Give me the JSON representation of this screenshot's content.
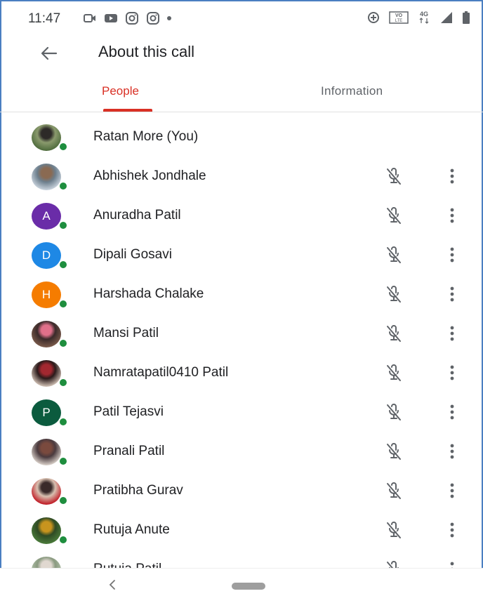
{
  "status_bar": {
    "time": "11:47",
    "left_icons": [
      "video-call-icon",
      "youtube-icon",
      "instagram-icon",
      "instagram-icon"
    ],
    "right_icons": [
      "data-saver-icon",
      "volte-icon",
      "4g-icon",
      "signal-icon",
      "battery-icon"
    ],
    "right_text": {
      "volte": "VO LTE",
      "network": "4G"
    }
  },
  "app_bar": {
    "title": "About this call"
  },
  "tabs": [
    {
      "label": "People",
      "selected": true
    },
    {
      "label": "Information",
      "selected": false
    }
  ],
  "colors": {
    "accent": "#d93025",
    "online": "#1e8e3e",
    "text_primary": "#202124",
    "text_secondary": "#5f6368"
  },
  "people": [
    {
      "name": "Ratan More (You)",
      "avatar_type": "photo",
      "photo_colors": [
        "#4e6b3c",
        "#2d2a28",
        "#8a9a6d"
      ],
      "is_self": true
    },
    {
      "name": "Abhishek Jondhale",
      "avatar_type": "photo",
      "photo_colors": [
        "#c8d2dc",
        "#8a6a52",
        "#6c7e8c"
      ],
      "is_self": false
    },
    {
      "name": "Anuradha Patil",
      "avatar_type": "letter",
      "letter": "A",
      "color": "#6a2ca8",
      "is_self": false
    },
    {
      "name": "Dipali Gosavi",
      "avatar_type": "letter",
      "letter": "D",
      "color": "#1e88e5",
      "is_self": false
    },
    {
      "name": "Harshada Chalake",
      "avatar_type": "letter",
      "letter": "H",
      "color": "#f57c00",
      "is_self": false
    },
    {
      "name": "Mansi Patil",
      "avatar_type": "photo",
      "photo_colors": [
        "#7a5a4a",
        "#e0708a",
        "#3a2a2a"
      ],
      "is_self": false
    },
    {
      "name": "Namratapatil0410 Patil",
      "avatar_type": "photo",
      "photo_colors": [
        "#d0c0b4",
        "#a22830",
        "#2a1a1a"
      ],
      "is_self": false
    },
    {
      "name": "Patil Tejasvi",
      "avatar_type": "letter",
      "letter": "P",
      "color": "#0b5b3e",
      "is_self": false
    },
    {
      "name": "Pranali Patil",
      "avatar_type": "photo",
      "photo_colors": [
        "#d8cfc8",
        "#7a4a3e",
        "#4a3a3e"
      ],
      "is_self": false
    },
    {
      "name": "Pratibha Gurav",
      "avatar_type": "photo",
      "photo_colors": [
        "#c01a24",
        "#3a2a2a",
        "#d8c0b0"
      ],
      "is_self": false
    },
    {
      "name": "Rutuja Anute",
      "avatar_type": "photo",
      "photo_colors": [
        "#4a7a3a",
        "#c8941e",
        "#2e4a24"
      ],
      "is_self": false
    },
    {
      "name": "Rutuja Patil",
      "avatar_type": "photo",
      "photo_colors": [
        "#b8c8b0",
        "#e0d8d0",
        "#8a9a80"
      ],
      "is_self": false
    }
  ],
  "nav_bar": {
    "icons": [
      "nav-back-icon",
      "home-pill-icon"
    ]
  }
}
